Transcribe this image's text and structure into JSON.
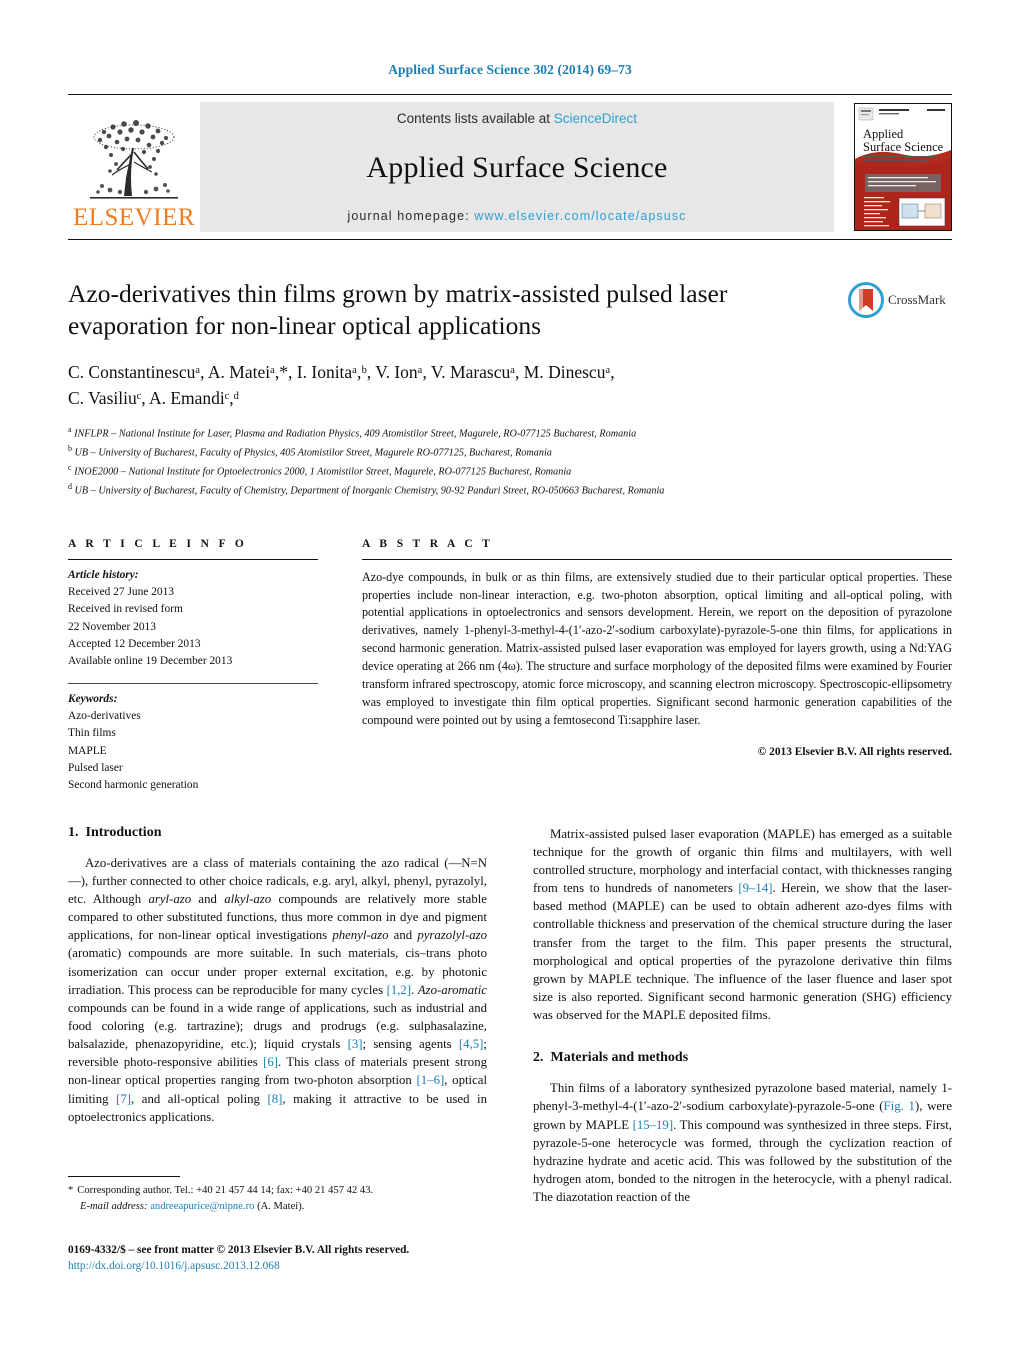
{
  "running_head": "Applied Surface Science 302 (2014) 69–73",
  "masthead": {
    "publisher_name": "ELSEVIER",
    "contents_prefix": "Contents lists available at",
    "sciencedirect": "ScienceDirect",
    "journal_name": "Applied Surface Science",
    "homepage_label": "journal homepage:",
    "homepage_url": "www.elsevier.com/locate/apsusc",
    "cover_title_line1": "Applied",
    "cover_title_line2": "Surface Science"
  },
  "article": {
    "title": "Azo-derivatives thin films grown by matrix-assisted pulsed laser evaporation for non-linear optical applications",
    "crossmark_label": "CrossMark",
    "authors_line1": "C. Constantinescuᵃ, A. Mateiᵃ,*, I. Ionitaᵃ,ᵇ, V. Ionᵃ, V. Marascuᵃ, M. Dinescuᵃ,",
    "authors_line2": "C. Vasiliuᶜ, A. Emandiᶜ,ᵈ",
    "authors": [
      {
        "name": "C. Constantinescu",
        "sup": "a"
      },
      {
        "name": "A. Matei",
        "sup": "a,*"
      },
      {
        "name": "I. Ionita",
        "sup": "a,b"
      },
      {
        "name": "V. Ion",
        "sup": "a"
      },
      {
        "name": "V. Marascu",
        "sup": "a"
      },
      {
        "name": "M. Dinescu",
        "sup": "a"
      },
      {
        "name": "C. Vasiliu",
        "sup": "c"
      },
      {
        "name": "A. Emandi",
        "sup": "c,d"
      }
    ],
    "affiliations": [
      {
        "label": "a",
        "text": "INFLPR – National Institute for Laser, Plasma and Radiation Physics, 409 Atomistilor Street, Magurele, RO-077125 Bucharest, Romania"
      },
      {
        "label": "b",
        "text": "UB – University of Bucharest, Faculty of Physics, 405 Atomistilor Street, Magurele RO-077125, Bucharest, Romania"
      },
      {
        "label": "c",
        "text": "INOE2000 – National Institute for Optoelectronics 2000, 1 Atomistilor Street, Magurele, RO-077125 Bucharest, Romania"
      },
      {
        "label": "d",
        "text": "UB – University of Bucharest, Faculty of Chemistry, Department of Inorganic Chemistry, 90-92 Panduri Street, RO-050663 Bucharest, Romania"
      }
    ]
  },
  "article_info": {
    "heading": "A R T I C L E   I N F O",
    "history_label": "Article history:",
    "history": [
      "Received 27 June 2013",
      "Received in revised form",
      "22 November 2013",
      "Accepted 12 December 2013",
      "Available online 19 December 2013"
    ],
    "keywords_label": "Keywords:",
    "keywords": [
      "Azo-derivatives",
      "Thin films",
      "MAPLE",
      "Pulsed laser",
      "Second harmonic generation"
    ]
  },
  "abstract": {
    "heading": "A B S T R A C T",
    "text": "Azo-dye compounds, in bulk or as thin films, are extensively studied due to their particular optical properties. These properties include non-linear interaction, e.g. two-photon absorption, optical limiting and all-optical poling, with potential applications in optoelectronics and sensors development. Herein, we report on the deposition of pyrazolone derivatives, namely 1-phenyl-3-methyl-4-(1′-azo-2′-sodium carboxylate)-pyrazole-5-one thin films, for applications in second harmonic generation. Matrix-assisted pulsed laser evaporation was employed for layers growth, using a Nd:YAG device operating at 266 nm (4ω). The structure and surface morphology of the deposited films were examined by Fourier transform infrared spectroscopy, atomic force microscopy, and scanning electron microscopy. Spectroscopic-ellipsometry was employed to investigate thin film optical properties. Significant second harmonic generation capabilities of the compound were pointed out by using a femtosecond Ti:sapphire laser.",
    "copyright": "© 2013 Elsevier B.V. All rights reserved."
  },
  "sections": {
    "introduction": {
      "number": "1.",
      "title": "Introduction",
      "paragraph1_parts": [
        {
          "t": "Azo-derivatives are a class of materials containing the azo radical (—N=N—), further connected to other choice radicals, e.g. aryl, alkyl, phenyl, pyrazolyl, etc. Although "
        },
        {
          "t": "aryl-azo",
          "style": "i"
        },
        {
          "t": " and "
        },
        {
          "t": "alkyl-azo",
          "style": "i"
        },
        {
          "t": " compounds are relatively more stable compared to other substituted functions, thus more common in dye and pigment applications, for non-linear optical investigations "
        },
        {
          "t": "phenyl-azo",
          "style": "i"
        },
        {
          "t": " and "
        },
        {
          "t": "pyrazolyl-azo",
          "style": "i"
        },
        {
          "t": " (aromatic) compounds are more suitable. In such materials, cis–trans photo isomerization can occur under proper external excitation, e.g. by photonic irradiation. This process can be reproducible for many cycles "
        },
        {
          "t": "[1,2]",
          "style": "ref"
        },
        {
          "t": ". "
        },
        {
          "t": "Azo-aromatic",
          "style": "i"
        },
        {
          "t": " compounds can be found in a wide range of applications, such as industrial and food coloring (e.g. tartrazine); drugs and prodrugs (e.g. sulphasalazine, balsalazide, phenazopyridine, etc.); liquid crystals "
        },
        {
          "t": "[3]",
          "style": "ref"
        },
        {
          "t": "; sensing agents "
        },
        {
          "t": "[4,5]",
          "style": "ref"
        },
        {
          "t": "; reversible photo-responsive abilities "
        },
        {
          "t": "[6]",
          "style": "ref"
        },
        {
          "t": ". This class of materials present strong non-linear optical properties ranging from two-photon absorption "
        },
        {
          "t": "[1–6]",
          "style": "ref"
        },
        {
          "t": ", optical limiting "
        },
        {
          "t": "[7]",
          "style": "ref"
        },
        {
          "t": ", and all-optical poling "
        },
        {
          "t": "[8]",
          "style": "ref"
        },
        {
          "t": ", making it attractive to be used in optoelectronics applications."
        }
      ],
      "paragraph2_parts": [
        {
          "t": "Matrix-assisted pulsed laser evaporation (MAPLE) has emerged as a suitable technique for the growth of organic thin films and multilayers, with well controlled structure, morphology and interfacial contact, with thicknesses ranging from tens to hundreds of nanometers "
        },
        {
          "t": "[9–14]",
          "style": "ref"
        },
        {
          "t": ". Herein, we show that the laser-based method (MAPLE) can be used to obtain adherent azo-dyes films with controllable thickness and preservation of the chemical structure during the laser transfer from the target to the film. This paper presents the structural, morphological and optical properties of the pyrazolone derivative thin films grown by MAPLE technique. The influence of the laser fluence and laser spot size is also reported. Significant second harmonic generation (SHG) efficiency was observed for the MAPLE deposited films."
        }
      ]
    },
    "materials": {
      "number": "2.",
      "title": "Materials and methods",
      "paragraph1_parts": [
        {
          "t": "Thin films of a laboratory synthesized pyrazolone based material, namely 1-phenyl-3-methyl-4-(1′-azo-2′-sodium carboxylate)-pyrazole-5-one ("
        },
        {
          "t": "Fig. 1",
          "style": "ref"
        },
        {
          "t": "), were grown by MAPLE "
        },
        {
          "t": "[15–19]",
          "style": "ref"
        },
        {
          "t": ". This compound was synthesized in three steps. First, pyrazole-5-one heterocycle was formed, through the cyclization reaction of hydrazine hydrate and acetic acid. This was followed by the substitution of the hydrogen atom, bonded to the nitrogen in the heterocycle, with a phenyl radical. The diazotation reaction of the"
        }
      ]
    }
  },
  "footnote": {
    "star": "*",
    "corresponding": "Corresponding author. Tel.: +40 21 457 44 14; fax: +40 21 457 42 43.",
    "email_label": "E-mail address:",
    "email": "andreeapurice@nipne.ro",
    "email_owner": "(A. Matei)."
  },
  "footer": {
    "issn_line": "0169-4332/$ – see front matter © 2013 Elsevier B.V. All rights reserved.",
    "doi": "http://dx.doi.org/10.1016/j.apsusc.2013.12.068"
  },
  "colors": {
    "link_blue": "#1a7fb5",
    "sciencedirect_blue": "#2f9fd0",
    "elsevier_orange": "#F07C1F",
    "band_gray": "#e7e7e7",
    "crossmark_red": "#d23b26"
  }
}
